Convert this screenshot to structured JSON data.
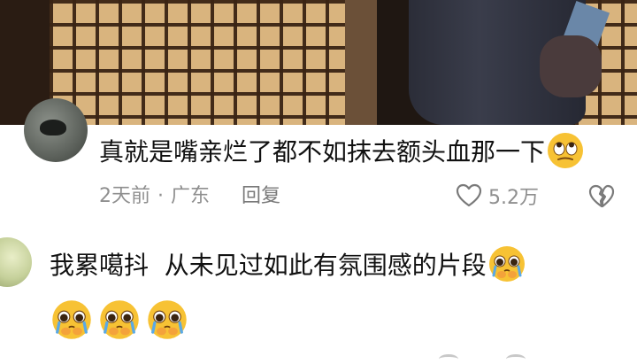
{
  "comments": [
    {
      "text": "真就是嘴亲烂了都不如抹去额头血那一下",
      "emoji": "rolling-eyes-emoji",
      "time": "2天前",
      "separator": "·",
      "location": "广东",
      "reply_label": "回复",
      "likes": "5.2万"
    },
    {
      "text": "我累噶抖  从未见过如此有氛围感的片段",
      "emoji": "pleading-face-emoji",
      "emoji_row": [
        "pleading-face-emoji",
        "pleading-face-emoji",
        "pleading-face-emoji"
      ]
    }
  ],
  "colors": {
    "text": "#111111",
    "meta": "#8f8f8f",
    "emoji_face": "#f7c234"
  }
}
